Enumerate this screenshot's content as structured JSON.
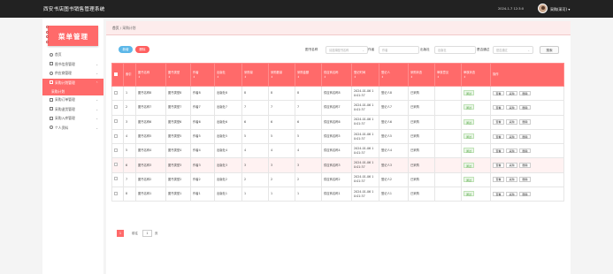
{
  "app": {
    "title": "西安书店图书销售管理系统",
    "clock": "2024-1-7 12:3:0",
    "user": "采购(采可) ▾"
  },
  "logo": {
    "text": "菜单管理"
  },
  "sidebar": {
    "items": [
      {
        "label": "首页",
        "icon": "home-icon",
        "arrow": ""
      },
      {
        "label": "图书信息管理",
        "icon": "book-icon",
        "arrow": "⌄"
      },
      {
        "label": "供应商管理",
        "icon": "supplier-icon",
        "arrow": "⌄"
      },
      {
        "label": "采购计划管理",
        "icon": "plan-icon",
        "arrow": "⌃"
      },
      {
        "label": "采购计划",
        "icon": "",
        "arrow": ""
      },
      {
        "label": "采购订单管理",
        "icon": "order-icon",
        "arrow": "⌄"
      },
      {
        "label": "采购退货管理",
        "icon": "return-icon",
        "arrow": "⌄"
      },
      {
        "label": "采购入库管理",
        "icon": "storage-icon",
        "arrow": "⌄"
      },
      {
        "label": "个人资料",
        "icon": "user-icon",
        "arrow": "⌄"
      }
    ]
  },
  "breadcrumb": {
    "home": "首页",
    "sep": " / ",
    "current": "采购计划"
  },
  "toolbar": {
    "add": "新增",
    "delete": "删除",
    "search": "搜索"
  },
  "filters": {
    "book_name": {
      "label": "图书名称",
      "placeholder": "请选择图书名称",
      "caret": "⌄"
    },
    "author": {
      "label": "作者",
      "placeholder": "作者"
    },
    "publisher": {
      "label": "出版社",
      "placeholder": "出版社"
    },
    "approved": {
      "label": "是否通过",
      "placeholder": "是否通过",
      "caret": "⌄"
    }
  },
  "table": {
    "headers": [
      {
        "label": "",
        "sort": ""
      },
      {
        "label": "索引",
        "sort": ""
      },
      {
        "label": "图书名称",
        "sort": "⇕"
      },
      {
        "label": "图书类型",
        "sort": "⇕"
      },
      {
        "label": "作者",
        "sort": "⇕"
      },
      {
        "label": "出版社",
        "sort": "⇕"
      },
      {
        "label": "采购量",
        "sort": "⇕"
      },
      {
        "label": "采购数量",
        "sort": "⇕"
      },
      {
        "label": "采购金额",
        "sort": "⇕"
      },
      {
        "label": "供应商名称",
        "sort": "⇕"
      },
      {
        "label": "登记时间",
        "sort": "⇕"
      },
      {
        "label": "登记人",
        "sort": "⇕"
      },
      {
        "label": "采购状态",
        "sort": "⇕"
      },
      {
        "label": "审核意见",
        "sort": "⇕"
      },
      {
        "label": "审核状态",
        "sort": "⇕"
      },
      {
        "label": "操作",
        "sort": ""
      }
    ],
    "rows": [
      {
        "idx": "1",
        "name": "图书名称8",
        "type": "图书类型8",
        "author": "作者8",
        "pub": "出版社8",
        "qty": "8",
        "num": "8",
        "amount": "8",
        "supplier": "供应商名称8",
        "time1": "2024-01-06 1",
        "time2": "0:01:37",
        "reg": "登记人8",
        "status": "已采购",
        "opinion": "",
        "audit": "通过"
      },
      {
        "idx": "2",
        "name": "图书名称7",
        "type": "图书类型7",
        "author": "作者7",
        "pub": "出版社7",
        "qty": "7",
        "num": "7",
        "amount": "7",
        "supplier": "供应商名称7",
        "time1": "2024-01-06 1",
        "time2": "0:01:37",
        "reg": "登记人7",
        "status": "已采购",
        "opinion": "",
        "audit": "通过"
      },
      {
        "idx": "3",
        "name": "图书名称6",
        "type": "图书类型6",
        "author": "作者6",
        "pub": "出版社6",
        "qty": "6",
        "num": "6",
        "amount": "6",
        "supplier": "供应商名称6",
        "time1": "2024-01-06 1",
        "time2": "0:01:37",
        "reg": "登记人6",
        "status": "已采购",
        "opinion": "",
        "audit": "通过"
      },
      {
        "idx": "4",
        "name": "图书名称5",
        "type": "图书类型5",
        "author": "作者5",
        "pub": "出版社5",
        "qty": "5",
        "num": "5",
        "amount": "5",
        "supplier": "供应商名称5",
        "time1": "2024-01-06 1",
        "time2": "0:01:37",
        "reg": "登记人5",
        "status": "已采购",
        "opinion": "",
        "audit": "通过"
      },
      {
        "idx": "5",
        "name": "图书名称4",
        "type": "图书类型4",
        "author": "作者4",
        "pub": "出版社4",
        "qty": "4",
        "num": "4",
        "amount": "4",
        "supplier": "供应商名称4",
        "time1": "2024-01-06 1",
        "time2": "0:01:37",
        "reg": "登记人4",
        "status": "已采购",
        "opinion": "",
        "audit": "通过"
      },
      {
        "idx": "6",
        "name": "图书名称3",
        "type": "图书类型3",
        "author": "作者3",
        "pub": "出版社3",
        "qty": "3",
        "num": "3",
        "amount": "3",
        "supplier": "供应商名称3",
        "time1": "2024-01-06 1",
        "time2": "0:01:37",
        "reg": "登记人3",
        "status": "已采购",
        "opinion": "",
        "audit": "通过"
      },
      {
        "idx": "7",
        "name": "图书名称2",
        "type": "图书类型2",
        "author": "作者2",
        "pub": "出版社2",
        "qty": "2",
        "num": "2",
        "amount": "2",
        "supplier": "供应商名称2",
        "time1": "2024-01-06 1",
        "time2": "0:01:37",
        "reg": "登记人2",
        "status": "已采购",
        "opinion": "",
        "audit": "通过"
      },
      {
        "idx": "8",
        "name": "图书名称1",
        "type": "图书类型1",
        "author": "作者1",
        "pub": "出版社1",
        "qty": "1",
        "num": "1",
        "amount": "1",
        "supplier": "供应商名称1",
        "time1": "2024-01-06 1",
        "time2": "0:01:37",
        "reg": "登记人1",
        "status": "已采购",
        "opinion": "",
        "audit": "通过"
      }
    ],
    "ops": {
      "view": "查看",
      "purchase": "采购",
      "delete": "删除"
    }
  },
  "pager": {
    "current": "1",
    "goto": "前往",
    "page_input": "1",
    "page_unit": "页"
  },
  "colors": {
    "accent": "#ff6a6a",
    "add_button": "#5cb7e8",
    "delete_button": "#ff5e5e",
    "topbar": "#222222"
  }
}
